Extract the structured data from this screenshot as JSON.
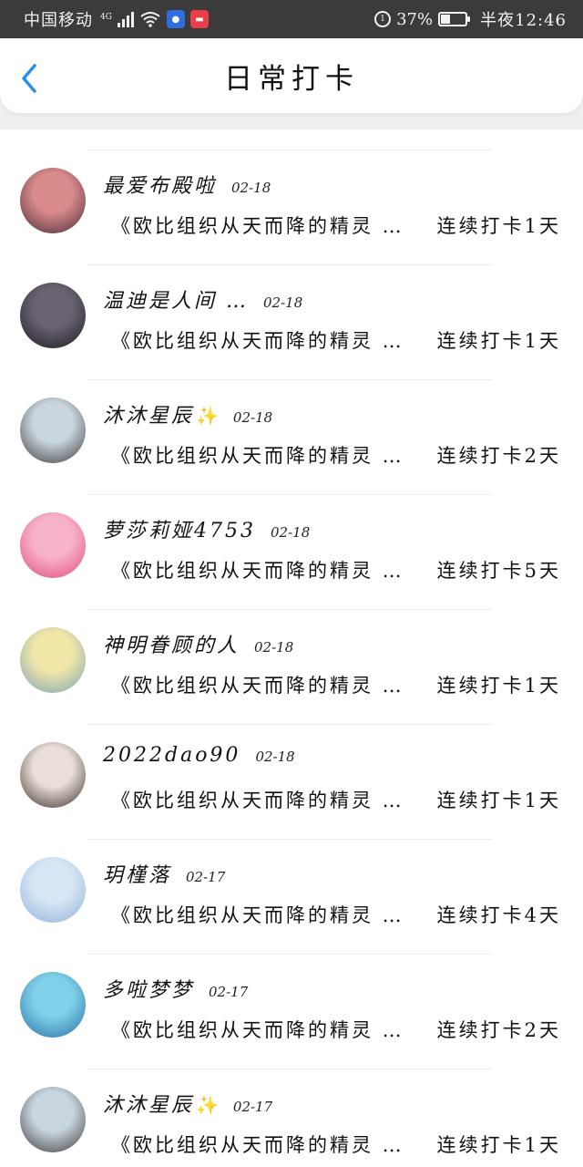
{
  "status_bar": {
    "carrier": "中国移动",
    "network": "4G",
    "battery_text": "37%",
    "battery_level": 0.37,
    "time": "半夜12:46",
    "icons": [
      "signal-icon",
      "wifi-icon",
      "baidu-app-icon",
      "huawei-app-icon",
      "alarm-icon",
      "battery-icon"
    ]
  },
  "header": {
    "title": "日常打卡",
    "back_icon": "chevron-left-icon",
    "accent": "#2a8ff2"
  },
  "checkins": [
    {
      "name": "最爱布殿啦",
      "sparkle": false,
      "date": "02-18",
      "quote": "《欧比组织从天而降的精灵 …",
      "streak": "连续打卡1天",
      "avatar_colors": [
        "#d98a8a",
        "#4a2b3a"
      ]
    },
    {
      "name": "温迪是人间 …",
      "sparkle": false,
      "date": "02-18",
      "quote": "《欧比组织从天而降的精灵 …",
      "streak": "连续打卡1天",
      "avatar_colors": [
        "#6a6270",
        "#1c1a22"
      ]
    },
    {
      "name": "沐沐星辰",
      "sparkle": true,
      "date": "02-18",
      "quote": "《欧比组织从天而降的精灵 …",
      "streak": "连续打卡2天",
      "avatar_colors": [
        "#c9d6df",
        "#3d3a3a"
      ]
    },
    {
      "name": "萝莎莉娅4753",
      "sparkle": false,
      "date": "02-18",
      "quote": "《欧比组织从天而降的精灵 …",
      "streak": "连续打卡5天",
      "avatar_colors": [
        "#f7b3c9",
        "#e04b7c"
      ]
    },
    {
      "name": "神明眷顾的人",
      "sparkle": false,
      "date": "02-18",
      "quote": "《欧比组织从天而降的精灵 …",
      "streak": "连续打卡1天",
      "avatar_colors": [
        "#efe6a8",
        "#7fa3b8"
      ]
    },
    {
      "name": "2022dao90",
      "sparkle": false,
      "date": "02-18",
      "quote": "《欧比组织从天而降的精灵 …",
      "streak": "连续打卡1天",
      "avatar_colors": [
        "#e9dfd8",
        "#3a2e2a"
      ]
    },
    {
      "name": "玥槿落",
      "sparkle": false,
      "date": "02-17",
      "quote": "《欧比组织从天而降的精灵 …",
      "streak": "连续打卡4天",
      "avatar_colors": [
        "#d7e6f5",
        "#8fb2d8"
      ]
    },
    {
      "name": "多啦梦梦",
      "sparkle": false,
      "date": "02-17",
      "quote": "《欧比组织从天而降的精灵 …",
      "streak": "连续打卡2天",
      "avatar_colors": [
        "#7fd0e8",
        "#2a6fa8"
      ]
    },
    {
      "name": "沐沐星辰",
      "sparkle": true,
      "date": "02-17",
      "quote": "《欧比组织从天而降的精灵 …",
      "streak": "连续打卡1天",
      "avatar_colors": [
        "#c9d6df",
        "#3d3a3a"
      ]
    }
  ]
}
